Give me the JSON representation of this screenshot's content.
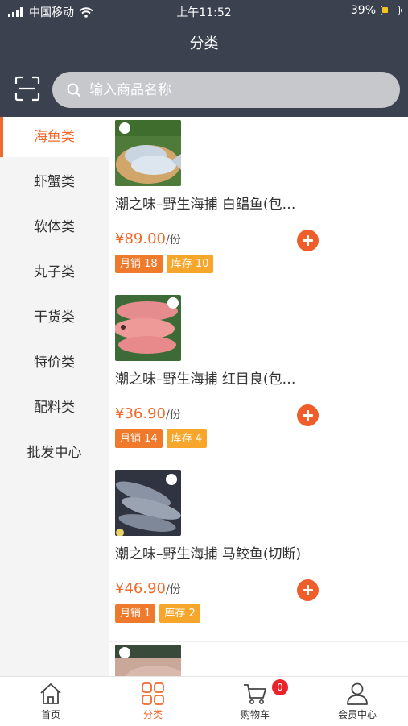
{
  "status_bar": {
    "carrier": "中国移动",
    "time": "上午11:52",
    "battery_text": "39%",
    "battery_level": 0.39
  },
  "header": {
    "title": "分类",
    "search_placeholder": "输入商品名称"
  },
  "sidebar": {
    "items": [
      {
        "label": "海鱼类",
        "active": true
      },
      {
        "label": "虾蟹类",
        "active": false
      },
      {
        "label": "软体类",
        "active": false
      },
      {
        "label": "丸子类",
        "active": false
      },
      {
        "label": "干货类",
        "active": false
      },
      {
        "label": "特价类",
        "active": false
      },
      {
        "label": "配料类",
        "active": false
      },
      {
        "label": "批发中心",
        "active": false
      }
    ]
  },
  "products": [
    {
      "name": "潮之味–野生海捕 白鲳鱼(包…",
      "price": "¥89.00",
      "unit": "/份",
      "sales": "月销 18",
      "stock": "库存 10"
    },
    {
      "name": "潮之味–野生海捕 红目良(包…",
      "price": "¥36.90",
      "unit": "/份",
      "sales": "月销 14",
      "stock": "库存 4"
    },
    {
      "name": "潮之味–野生海捕 马鲛鱼(切断)",
      "price": "¥46.90",
      "unit": "/份",
      "sales": "月销 1",
      "stock": "库存 2"
    }
  ],
  "tabbar": {
    "items": [
      {
        "label": "首页",
        "icon": "home-icon"
      },
      {
        "label": "分类",
        "icon": "grid-icon"
      },
      {
        "label": "购物车",
        "icon": "cart-icon"
      },
      {
        "label": "会员中心",
        "icon": "user-icon"
      }
    ],
    "cart_badge": "0"
  },
  "colors": {
    "header_bg": "#3b414f",
    "accent": "#ef6a2c",
    "tag_stock": "#f6a72b",
    "badge": "#e8232a"
  }
}
